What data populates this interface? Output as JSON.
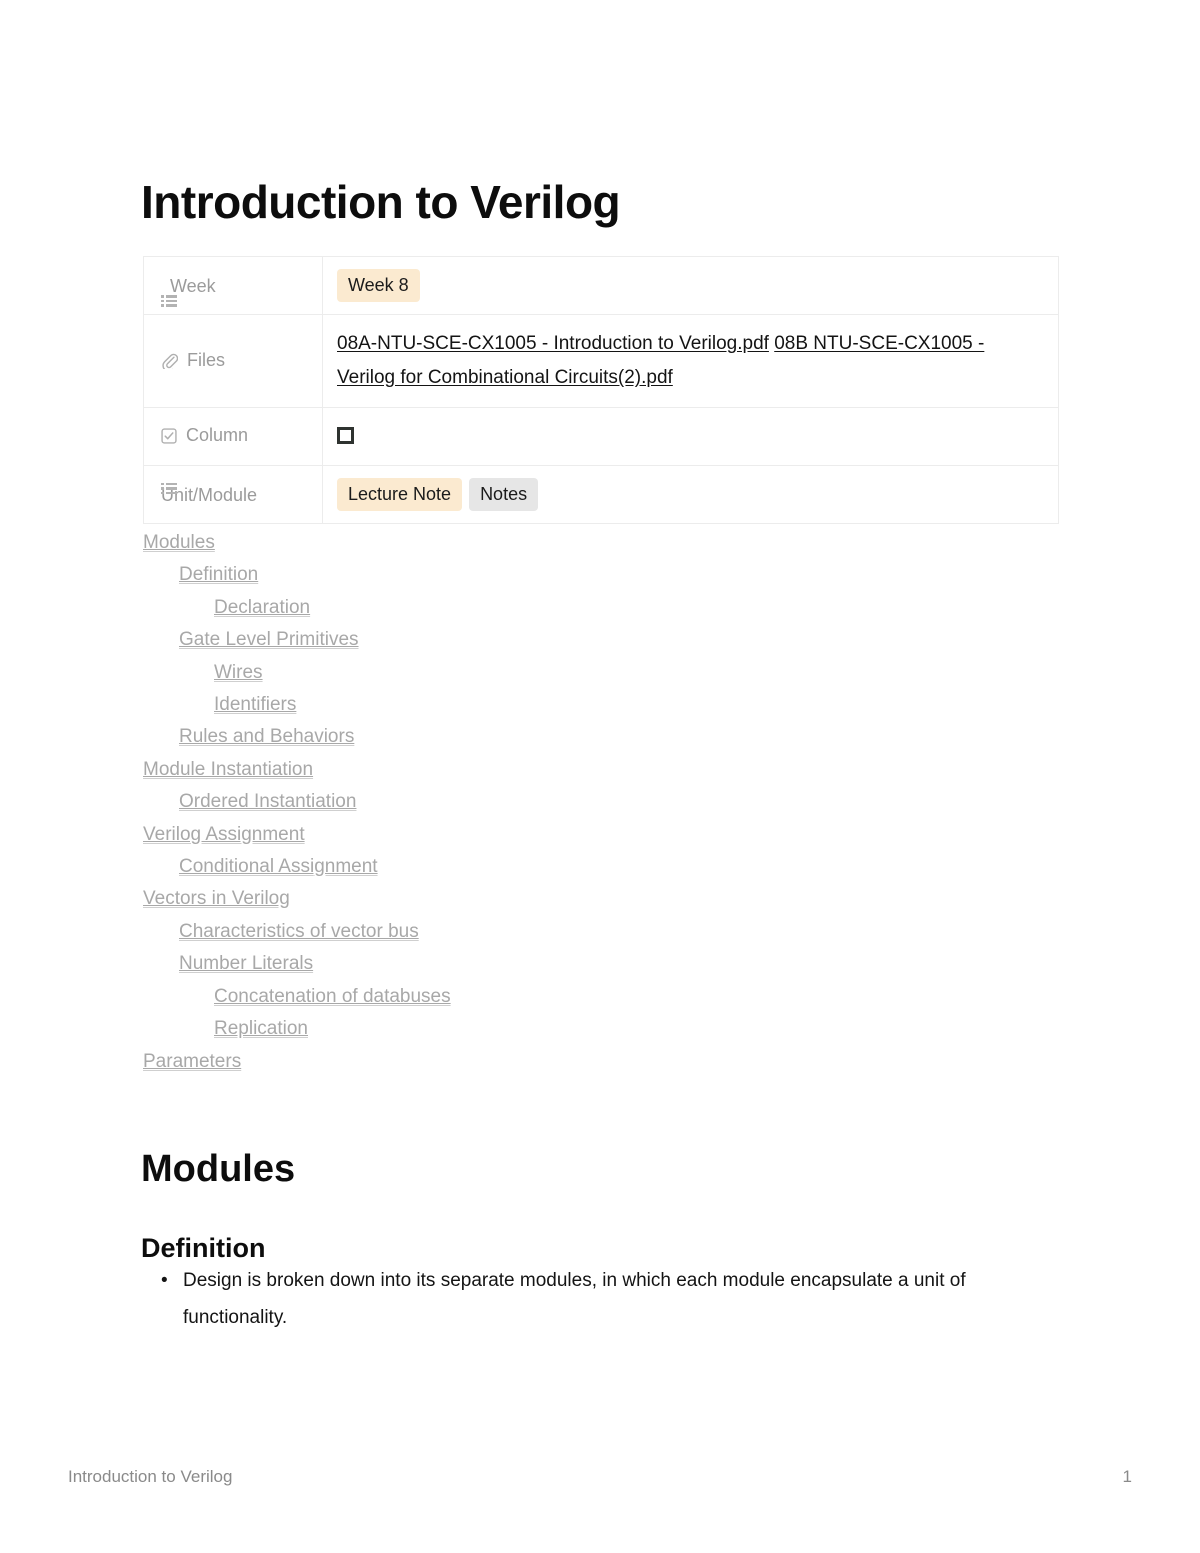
{
  "document": {
    "title": "Introduction to Verilog"
  },
  "properties": {
    "rows": [
      {
        "icon": "list-icon",
        "key": "Week",
        "type": "pills",
        "pills": [
          {
            "label": "Week 8",
            "color": "#fbead0"
          }
        ]
      },
      {
        "icon": "paperclip-icon",
        "key": "Files",
        "type": "files",
        "files": [
          "08A-NTU-SCE-CX1005 - Introduction to Verilog.pdf",
          "08B NTU-SCE-CX1005 - Verilog for Combinational Circuits(2).pdf"
        ]
      },
      {
        "icon": "checkbox-icon",
        "key": "Column",
        "type": "checkbox",
        "checked": false
      },
      {
        "icon": "list-icon",
        "key": "Unit/Module",
        "type": "pills",
        "pills": [
          {
            "label": "Lecture Note",
            "color": "#fbead0"
          },
          {
            "label": "Notes",
            "color": "#e6e6e6"
          }
        ]
      }
    ]
  },
  "table_of_contents": {
    "items": [
      {
        "label": "Modules",
        "level": 0
      },
      {
        "label": "Definition",
        "level": 1
      },
      {
        "label": "Declaration",
        "level": 2
      },
      {
        "label": "Gate Level Primitives",
        "level": 1
      },
      {
        "label": "Wires",
        "level": 2
      },
      {
        "label": "Identifiers",
        "level": 2
      },
      {
        "label": "Rules and Behaviors",
        "level": 1
      },
      {
        "label": "Module Instantiation",
        "level": 0
      },
      {
        "label": "Ordered Instantiation",
        "level": 1
      },
      {
        "label": "Verilog Assignment",
        "level": 0
      },
      {
        "label": "Conditional Assignment",
        "level": 1
      },
      {
        "label": "Vectors in Verilog",
        "level": 0
      },
      {
        "label": "Characteristics of vector bus",
        "level": 1
      },
      {
        "label": "Number Literals",
        "level": 1
      },
      {
        "label": "Concatenation of databuses",
        "level": 2
      },
      {
        "label": "Replication",
        "level": 2
      },
      {
        "label": "Parameters",
        "level": 0
      }
    ]
  },
  "content": {
    "heading1": "Modules",
    "heading2": "Definition",
    "bullets": [
      "Design is broken down into its separate modules, in which each module encapsulate a unit of functionality."
    ]
  },
  "footer": {
    "left": "Introduction to Verilog",
    "page_number": "1"
  }
}
